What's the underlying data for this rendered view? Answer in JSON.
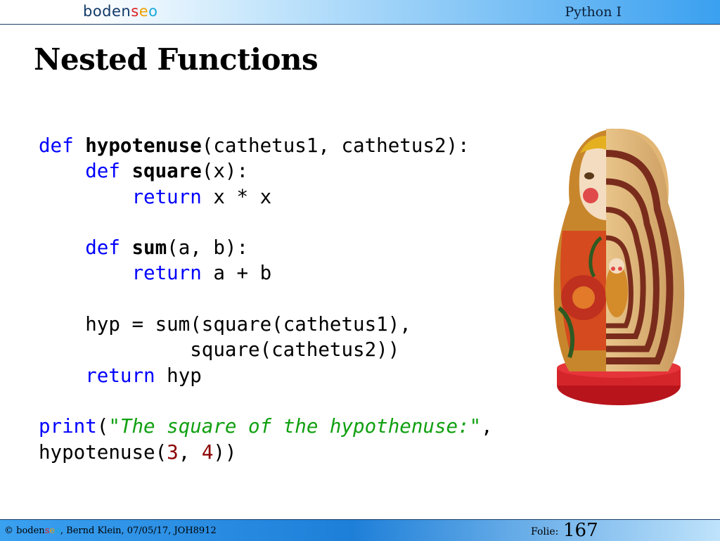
{
  "header": {
    "logo": {
      "part1": "boden",
      "s": "s",
      "e": "e",
      "o": "o"
    },
    "course": "Python I"
  },
  "slide": {
    "title": "Nested Functions"
  },
  "code": {
    "l1": {
      "kw": "def",
      "fn": "hypotenuse",
      "rest": "(cathetus1, cathetus2):"
    },
    "l2": {
      "kw": "def",
      "fn": "square",
      "rest": "(x):"
    },
    "l3": {
      "kw": "return",
      "rest": "x * x"
    },
    "l5": {
      "kw": "def",
      "fn": "sum",
      "rest": "(a, b):"
    },
    "l6": {
      "kw": "return",
      "rest": "a + b"
    },
    "l8": {
      "text": "hyp = sum(square(cathetus1),"
    },
    "l9": {
      "text": "square(cathetus2))"
    },
    "l10": {
      "kw": "return",
      "rest": "hyp"
    },
    "l12": {
      "kw": "print",
      "open": "(",
      "str": "\"The square of the hypothenuse:\"",
      "comma": ","
    },
    "l13": {
      "pre": "hypotenuse(",
      "n1": "3",
      "mid": ", ",
      "n2": "4",
      "post": "))"
    }
  },
  "image": {
    "name": "matryoshka-doll"
  },
  "footer": {
    "copyright": "©",
    "brand": {
      "part1": "boden",
      "s": "s",
      "e": "e",
      "o": "o"
    },
    "info": ", Bernd Klein, 07/05/17, JOH8912",
    "folie_label": "Folie:",
    "folie_number": "167"
  },
  "colors": {
    "keyword": "#0000ff",
    "string": "#10a010",
    "number": "#8b0000",
    "header_blue": "#3aa0f0"
  }
}
